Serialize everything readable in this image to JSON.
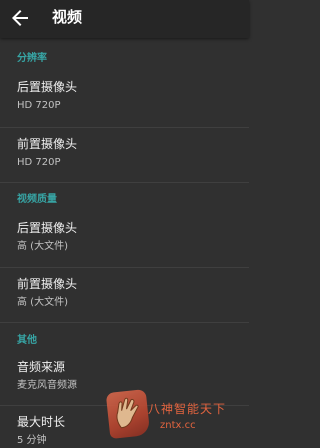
{
  "header": {
    "title": "视频",
    "back_icon": "arrow-back-icon"
  },
  "sections": [
    {
      "header": "分辨率",
      "items": [
        {
          "title": "后置摄像头",
          "summary": "HD 720P"
        },
        {
          "title": "前置摄像头",
          "summary": "HD 720P"
        }
      ]
    },
    {
      "header": "视频质量",
      "items": [
        {
          "title": "后置摄像头",
          "summary": "高 (大文件)"
        },
        {
          "title": "前置摄像头",
          "summary": "高 (大文件)"
        }
      ]
    },
    {
      "header": "其他",
      "items": [
        {
          "title": "音频来源",
          "summary": "麦克风音频源"
        },
        {
          "title": "最大时长",
          "summary": "5 分钟"
        }
      ]
    }
  ],
  "watermark": {
    "name": "八神智能天下",
    "url": "zntx.cc"
  },
  "colors": {
    "background": "#303030",
    "appbar": "#262626",
    "accent": "#37a4a4",
    "watermark": "#e3643f"
  }
}
